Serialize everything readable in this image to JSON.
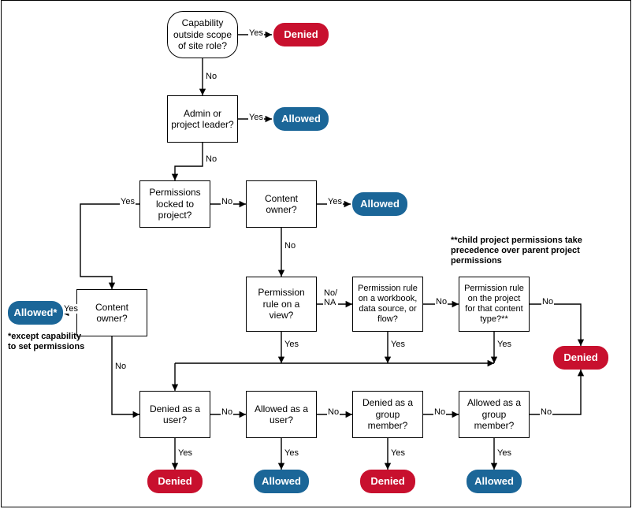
{
  "nodes": {
    "q_scope": "Capability outside scope of site role?",
    "q_admin": "Admin or project leader?",
    "q_locked": "Permissions locked to project?",
    "q_owner_a": "Content owner?",
    "q_owner_b": "Content owner?",
    "q_view_rule": "Permission rule on a view?",
    "q_wb_rule": "Permission rule on a workbook, data source, or flow?",
    "q_proj_rule": "Permission rule on the project for that content type?**",
    "q_user_denied": "Denied as a user?",
    "q_user_allowed": "Allowed as a user?",
    "q_group_denied": "Denied as a group member?",
    "q_group_allowed": "Allowed as a group member?"
  },
  "terminals": {
    "denied": "Denied",
    "allowed": "Allowed",
    "allowed_star": "Allowed*"
  },
  "edge_labels": {
    "yes": "Yes",
    "no": "No",
    "no_na": "No/\nNA"
  },
  "notes": {
    "except": "*except capability to set permissions",
    "child": "**child project permissions take precedence over parent project  permissions"
  },
  "chart_data": {
    "type": "table",
    "title": "Permission evaluation decision flowchart",
    "nodes": [
      {
        "id": "q_scope",
        "type": "decision",
        "label": "Capability outside scope of site role?"
      },
      {
        "id": "t_denied_scope",
        "type": "terminal",
        "result": "Denied"
      },
      {
        "id": "q_admin",
        "type": "decision",
        "label": "Admin or project leader?"
      },
      {
        "id": "t_allowed_admin",
        "type": "terminal",
        "result": "Allowed"
      },
      {
        "id": "q_locked",
        "type": "decision",
        "label": "Permissions locked to project?"
      },
      {
        "id": "q_owner_a",
        "type": "decision",
        "label": "Content owner? (locked branch)"
      },
      {
        "id": "t_allowed_owner_a",
        "type": "terminal",
        "result": "Allowed* (*except capability to set permissions)"
      },
      {
        "id": "q_owner_b",
        "type": "decision",
        "label": "Content owner? (unlocked branch)"
      },
      {
        "id": "t_allowed_owner_b",
        "type": "terminal",
        "result": "Allowed"
      },
      {
        "id": "q_view_rule",
        "type": "decision",
        "label": "Permission rule on a view?"
      },
      {
        "id": "q_wb_rule",
        "type": "decision",
        "label": "Permission rule on a workbook, data source, or flow?"
      },
      {
        "id": "q_proj_rule",
        "type": "decision",
        "label": "Permission rule on the project for that content type? (**child project permissions take precedence over parent project permissions)"
      },
      {
        "id": "t_denied_noperm",
        "type": "terminal",
        "result": "Denied"
      },
      {
        "id": "q_user_denied",
        "type": "decision",
        "label": "Denied as a user?"
      },
      {
        "id": "t_denied_user",
        "type": "terminal",
        "result": "Denied"
      },
      {
        "id": "q_user_allowed",
        "type": "decision",
        "label": "Allowed as a user?"
      },
      {
        "id": "t_allowed_user",
        "type": "terminal",
        "result": "Allowed"
      },
      {
        "id": "q_group_denied",
        "type": "decision",
        "label": "Denied as a group member?"
      },
      {
        "id": "t_denied_group",
        "type": "terminal",
        "result": "Denied"
      },
      {
        "id": "q_group_allowed",
        "type": "decision",
        "label": "Allowed as a group member?"
      },
      {
        "id": "t_allowed_group",
        "type": "terminal",
        "result": "Allowed"
      }
    ],
    "edges": [
      {
        "from": "q_scope",
        "label": "Yes",
        "to": "t_denied_scope"
      },
      {
        "from": "q_scope",
        "label": "No",
        "to": "q_admin"
      },
      {
        "from": "q_admin",
        "label": "Yes",
        "to": "t_allowed_admin"
      },
      {
        "from": "q_admin",
        "label": "No",
        "to": "q_locked"
      },
      {
        "from": "q_locked",
        "label": "Yes",
        "to": "q_owner_a"
      },
      {
        "from": "q_locked",
        "label": "No",
        "to": "q_owner_b"
      },
      {
        "from": "q_owner_a",
        "label": "Yes",
        "to": "t_allowed_owner_a"
      },
      {
        "from": "q_owner_a",
        "label": "No",
        "to": "q_user_denied"
      },
      {
        "from": "q_owner_b",
        "label": "Yes",
        "to": "t_allowed_owner_b"
      },
      {
        "from": "q_owner_b",
        "label": "No",
        "to": "q_view_rule"
      },
      {
        "from": "q_view_rule",
        "label": "No/NA",
        "to": "q_wb_rule"
      },
      {
        "from": "q_view_rule",
        "label": "Yes",
        "to": "q_user_denied"
      },
      {
        "from": "q_wb_rule",
        "label": "No",
        "to": "q_proj_rule"
      },
      {
        "from": "q_wb_rule",
        "label": "Yes",
        "to": "q_user_denied"
      },
      {
        "from": "q_proj_rule",
        "label": "No",
        "to": "t_denied_noperm"
      },
      {
        "from": "q_proj_rule",
        "label": "Yes",
        "to": "q_user_denied"
      },
      {
        "from": "q_user_denied",
        "label": "Yes",
        "to": "t_denied_user"
      },
      {
        "from": "q_user_denied",
        "label": "No",
        "to": "q_user_allowed"
      },
      {
        "from": "q_user_allowed",
        "label": "Yes",
        "to": "t_allowed_user"
      },
      {
        "from": "q_user_allowed",
        "label": "No",
        "to": "q_group_denied"
      },
      {
        "from": "q_group_denied",
        "label": "Yes",
        "to": "t_denied_group"
      },
      {
        "from": "q_group_denied",
        "label": "No",
        "to": "q_group_allowed"
      },
      {
        "from": "q_group_allowed",
        "label": "Yes",
        "to": "t_allowed_group"
      },
      {
        "from": "q_group_allowed",
        "label": "No",
        "to": "t_denied_noperm"
      }
    ]
  }
}
